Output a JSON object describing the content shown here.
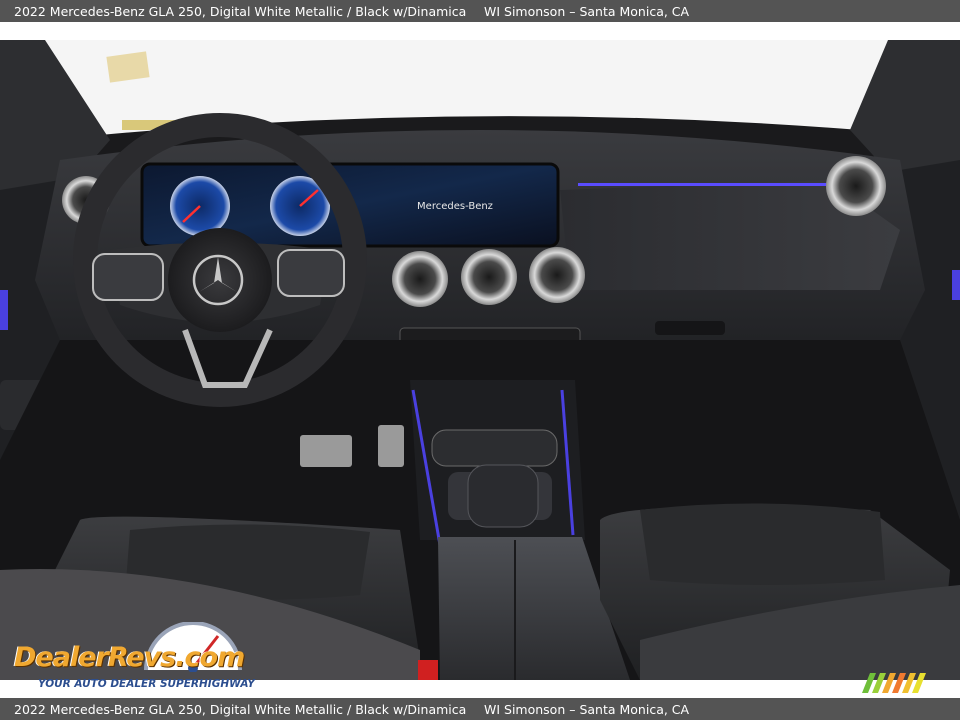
{
  "caption": {
    "vehicle": "2022 Mercedes-Benz GLA 250,  Digital White Metallic / Black w/Dinamica",
    "dealer": "WI Simonson – Santa Monica, CA"
  },
  "photo": {
    "screen_brand": "Mercedes-Benz"
  },
  "watermark": {
    "name": "DealerRevs.com",
    "tagline": "YOUR AUTO DEALER SUPERHIGHWAY"
  },
  "colors": {
    "caption_bar": "#545454",
    "ambient_light": "#5a4cff",
    "watermark_orange": "#f0a830",
    "watermark_blue": "#2c4e8f"
  }
}
